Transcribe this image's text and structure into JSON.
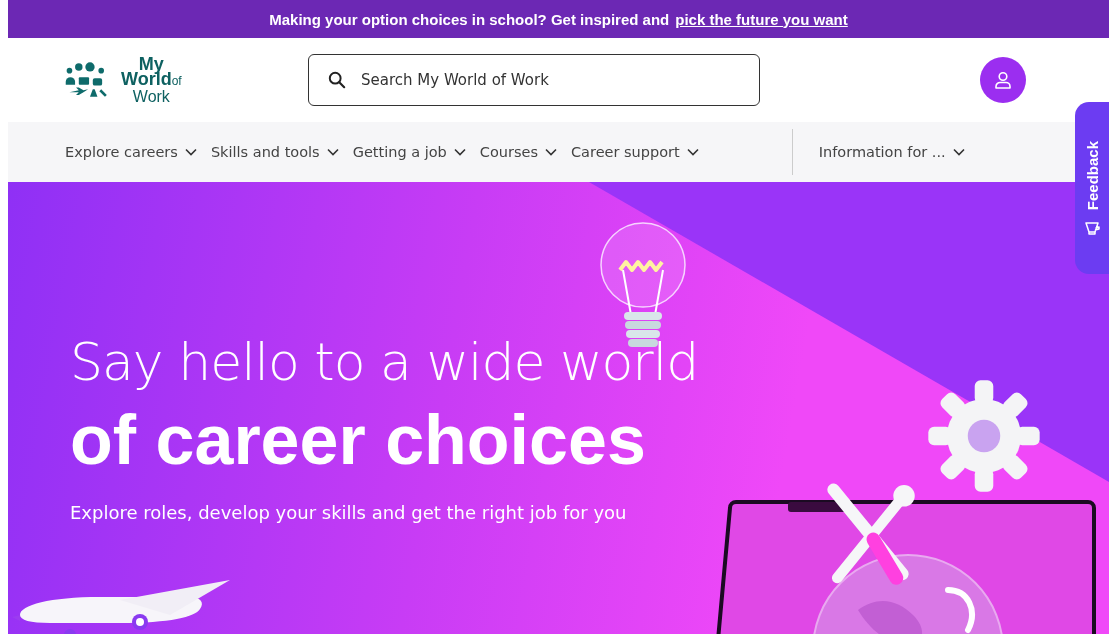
{
  "banner": {
    "text": "Making your option choices in school? Get inspired and",
    "link": "pick the future you want"
  },
  "logo": {
    "line_1": "My",
    "line_2": "World",
    "line_2_suffix": "of",
    "line_3": "Work"
  },
  "search": {
    "placeholder": "Search My World of Work"
  },
  "nav": {
    "items": [
      {
        "label": "Explore careers"
      },
      {
        "label": "Skills and tools"
      },
      {
        "label": "Getting a job"
      },
      {
        "label": "Courses"
      },
      {
        "label": "Career support"
      }
    ],
    "audience": {
      "label": "Information for ..."
    }
  },
  "feedback": {
    "label": "Feedback"
  },
  "hero": {
    "headline_light": "Say hello to a wide world",
    "headline_bold": "of career choices",
    "subtitle": "Explore roles, develop your skills and get the right job for you"
  }
}
